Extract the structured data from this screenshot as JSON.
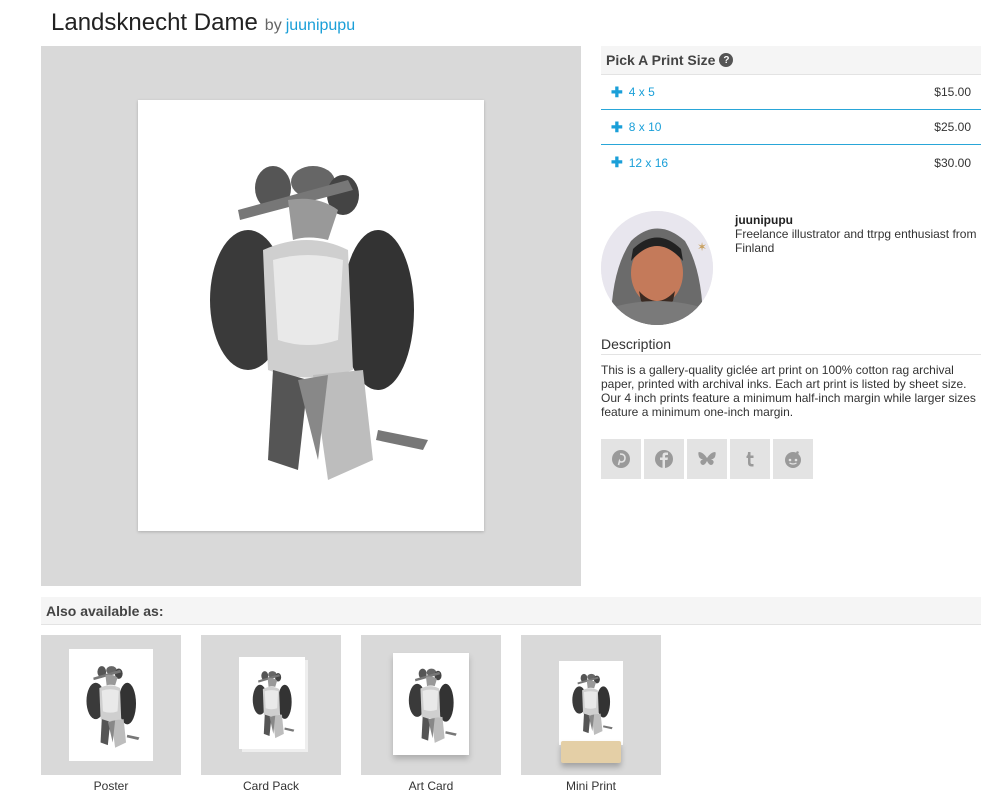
{
  "product": {
    "title": "Landsknecht Dame",
    "by_label": "by",
    "artist": "juunipupu"
  },
  "print_sizes": {
    "header": "Pick A Print Size",
    "help_glyph": "?",
    "plus_glyph": "✚",
    "options": [
      {
        "size": "4 x 5",
        "price": "$15.00"
      },
      {
        "size": "8 x 10",
        "price": "$25.00"
      },
      {
        "size": "12 x 16",
        "price": "$30.00"
      }
    ]
  },
  "artist_block": {
    "name": "juunipupu",
    "bio": "Freelance illustrator and ttrpg enthusiast from Finland"
  },
  "description": {
    "title": "Description",
    "text": "This is a gallery-quality giclée art print on 100% cotton rag archival paper, printed with archival inks. Each art print is listed by sheet size. Our 4 inch prints feature a minimum half-inch margin while larger sizes feature a minimum one-inch margin."
  },
  "share_icons": [
    "pinterest-icon",
    "facebook-icon",
    "bluesky-icon",
    "tumblr-icon",
    "reddit-icon"
  ],
  "also_available": {
    "header": "Also available as:",
    "items": [
      {
        "label": "Poster"
      },
      {
        "label": "Card Pack"
      },
      {
        "label": "Art Card"
      },
      {
        "label": "Mini Print"
      }
    ]
  },
  "colors": {
    "link": "#1a9fd8",
    "divider": "#29a6d8",
    "panel_bg": "#d9d9d9",
    "share_bg": "#e3e3e3"
  }
}
